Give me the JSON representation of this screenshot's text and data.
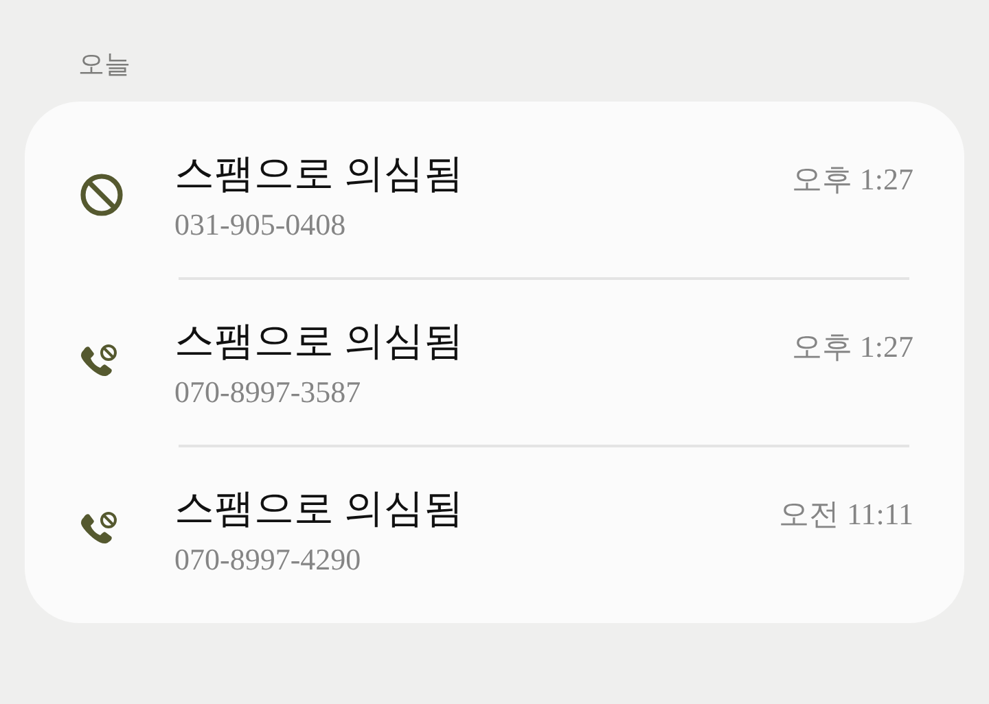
{
  "section": {
    "title": "오늘"
  },
  "calls": [
    {
      "kind": "blocked",
      "title": "스팸으로 의심됨",
      "number": "031-905-0408",
      "time": "오후 1:27"
    },
    {
      "kind": "blocked-call",
      "title": "스팸으로 의심됨",
      "number": "070-8997-3587",
      "time": "오후 1:27"
    },
    {
      "kind": "blocked-call",
      "title": "스팸으로 의심됨",
      "number": "070-8997-4290",
      "time": "오전 11:11"
    }
  ]
}
